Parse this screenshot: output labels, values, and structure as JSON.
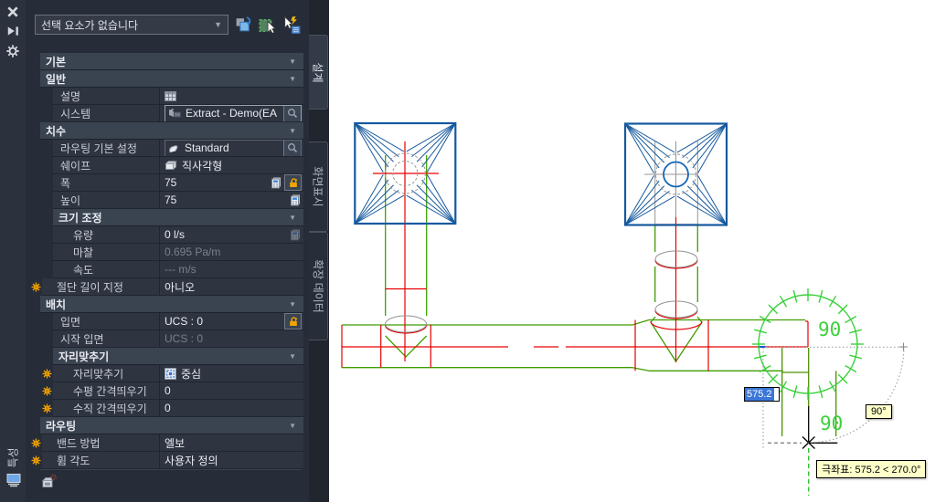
{
  "palette": {
    "title": "특성",
    "selection": "선택 요소가 없습니다",
    "toolbar_icons": [
      "pickadd-toggle",
      "select-objects",
      "quick-select"
    ],
    "tabs": [
      "설계",
      "화면표시",
      "확장 데이터"
    ],
    "rows": [
      {
        "type": "section",
        "label": "기본"
      },
      {
        "type": "section",
        "label": "일반"
      },
      {
        "type": "row",
        "label": "설명",
        "value": "",
        "vicon": "table"
      },
      {
        "type": "row",
        "label": "시스템",
        "value": "Extract - Demo(EA",
        "box": true,
        "vicon": "system",
        "search": true
      },
      {
        "type": "section",
        "label": "치수"
      },
      {
        "type": "row",
        "label": "라우팅 기본 설정",
        "value": "Standard",
        "box": true,
        "boxdim": true,
        "vicon": "routing",
        "search": true
      },
      {
        "type": "row",
        "label": "쉐이프",
        "value": "직사각형",
        "vicon": "shape"
      },
      {
        "type": "row",
        "label": "폭",
        "value": "75",
        "right": [
          "calc",
          "lock"
        ]
      },
      {
        "type": "row",
        "label": "높이",
        "value": "75",
        "right": [
          "calc"
        ]
      },
      {
        "type": "subsection",
        "label": "크기 조정"
      },
      {
        "type": "row",
        "label": "유량",
        "value": "0 l/s",
        "indent": 1,
        "right": [
          "calcdim"
        ]
      },
      {
        "type": "row",
        "label": "마찰",
        "value": "0.695 Pa/m",
        "indent": 1,
        "dim": true
      },
      {
        "type": "row",
        "label": "속도",
        "value": "--- m/s",
        "indent": 1,
        "dim": true
      },
      {
        "type": "row",
        "label": "절단 길이 지정",
        "value": "아니오",
        "sun": true,
        "gutter": true
      },
      {
        "type": "section",
        "label": "배치"
      },
      {
        "type": "row",
        "label": "입면",
        "value": "UCS : 0",
        "right": [
          "lock"
        ]
      },
      {
        "type": "row",
        "label": "시작 입면",
        "value": "UCS : 0",
        "dim": true
      },
      {
        "type": "subsection",
        "label": "자리맞추기"
      },
      {
        "type": "row",
        "label": "자리맞추기",
        "value": "중심",
        "vicon": "justify",
        "sun": true,
        "indent": 1
      },
      {
        "type": "row",
        "label": "수평 간격띄우기",
        "value": "0",
        "sun": true,
        "indent": 1
      },
      {
        "type": "row",
        "label": "수직 간격띄우기",
        "value": "0",
        "sun": true,
        "indent": 1
      },
      {
        "type": "section",
        "label": "라우팅"
      },
      {
        "type": "row",
        "label": "밴드 방법",
        "value": "엘보",
        "sun": true,
        "gutter": true
      },
      {
        "type": "row",
        "label": "휨 각도",
        "value": "사용자 정의",
        "sun": true,
        "gutter": true
      }
    ],
    "colors": {
      "header_bg": "#3a4350",
      "row_bg": "#2e3541",
      "accent_orange": "#f7a400"
    }
  },
  "drawing": {
    "dimension_top": "90",
    "dimension_bottom": "90",
    "dynamic_input_value": "575.2",
    "angle_tooltip": "90°",
    "polar_tooltip": "극좌표: 575.2 < 270.0°",
    "colors": {
      "duct_green": "#3f9e00",
      "branch_olive": "#4e8f00",
      "dim_green": "#3bd13b",
      "centerline_red": "#e60000",
      "diffuser_blue": "#15599f",
      "construction_gray": "#949494"
    }
  }
}
